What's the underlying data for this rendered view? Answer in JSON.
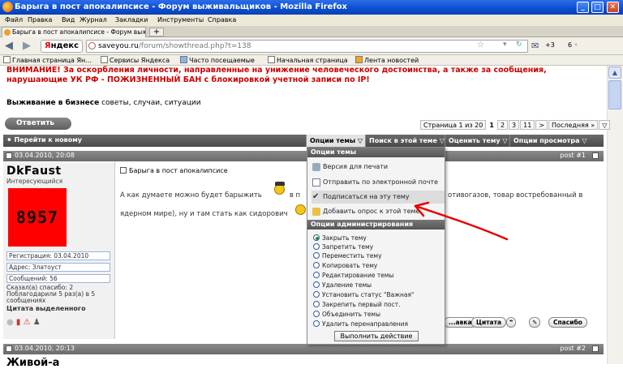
{
  "window": {
    "title": "Барыга в пост апокалипсисе - Форум выживальщиков - Mozilla Firefox"
  },
  "menu": [
    "Файл",
    "Правка",
    "Вид",
    "Журнал",
    "Закладки",
    "Инструменты",
    "Справка"
  ],
  "tabs": [
    {
      "label": "Барыга в пост апокалипсисе - Форум выж..."
    }
  ],
  "nav": {
    "yandex": "Яндекс",
    "url_domain": "saveyou.ru",
    "url_path": "/forum/showthread.php?t=138",
    "plus_count": "+3",
    "weather": "6 ◦"
  },
  "bookmarks": [
    "Главная страница Ян...",
    "Сервисы Яндекса",
    "Часто посещаемые",
    "Начальная страница",
    "Лента новостей"
  ],
  "warning": "ВНИМАНИЕ! За оскорбления личности, направленные на унижение человеческого достоинства, а также за сообщения, нарушающие УК РФ - ПОЖИЗНЕННЫЙ БАН с блокировкой учетной записи по IP!",
  "section": {
    "name": "Выживание в бизнесе",
    "desc": "советы, случаи, ситуации"
  },
  "reply_button": "Ответить",
  "pager": {
    "info": "Страница 1 из 20",
    "pages": [
      "1",
      "2",
      "3",
      "11"
    ],
    "last": "Последняя »",
    "next": ">"
  },
  "toolbar": {
    "goto": "Перейти к новому",
    "thread_options": "Опции темы",
    "search_thread": "Поиск в этой теме",
    "rate_thread": "Оценить тему",
    "view_options": "Опции просмотра"
  },
  "post1": {
    "date": "03.04.2010, 20:08",
    "number": "post #1",
    "username": "DkFaust",
    "user_title": "Интересующийся",
    "avatar_text": "8957",
    "reg": "Регистрация: 03.04.2010",
    "city": "Адрес: Златоуст",
    "messages": "Сообщений: 56",
    "thanks": "Сказал(а) спасибо: 2\nПоблагодарили 5 раз(а) в 5 сообщениях",
    "quote_label": "Цитата выделенного",
    "title": "Барыга в пост апокалипсисе",
    "text_line1": "А как думаете можно будет барыжить",
    "text_line1_mid": "в п",
    "text_right": "отивогазов, товар востребованный в",
    "text_line2": "ядерном мире), ну и там стать как сидорович",
    "buttons": [
      "...авка",
      "Цитата",
      "Спасибо"
    ]
  },
  "post2": {
    "date": "03.04.2010, 20:13",
    "number": "post #2",
    "username": "Живой-а"
  },
  "dropdown": {
    "section1": "Опции темы",
    "items": [
      "Версия для печати",
      "Отправить по электронной почте",
      "Подписаться на эту тему",
      "Добавить опрос к этой теме"
    ],
    "section2": "Опции администрирования",
    "admin": [
      "Закрыть тему",
      "Запретить тему",
      "Переместить тему",
      "Копировать тему",
      "Редактирование темы",
      "Удаление темы",
      "Установить статус \"Важная\"",
      "Закрепить первый пост.",
      "Объединить темы",
      "Удалить перенаправления"
    ],
    "execute": "Выполнить действие"
  },
  "colors": {
    "warning": "#cc0000",
    "avatar_bg": "#ff0000",
    "arrow": "#e60000"
  }
}
